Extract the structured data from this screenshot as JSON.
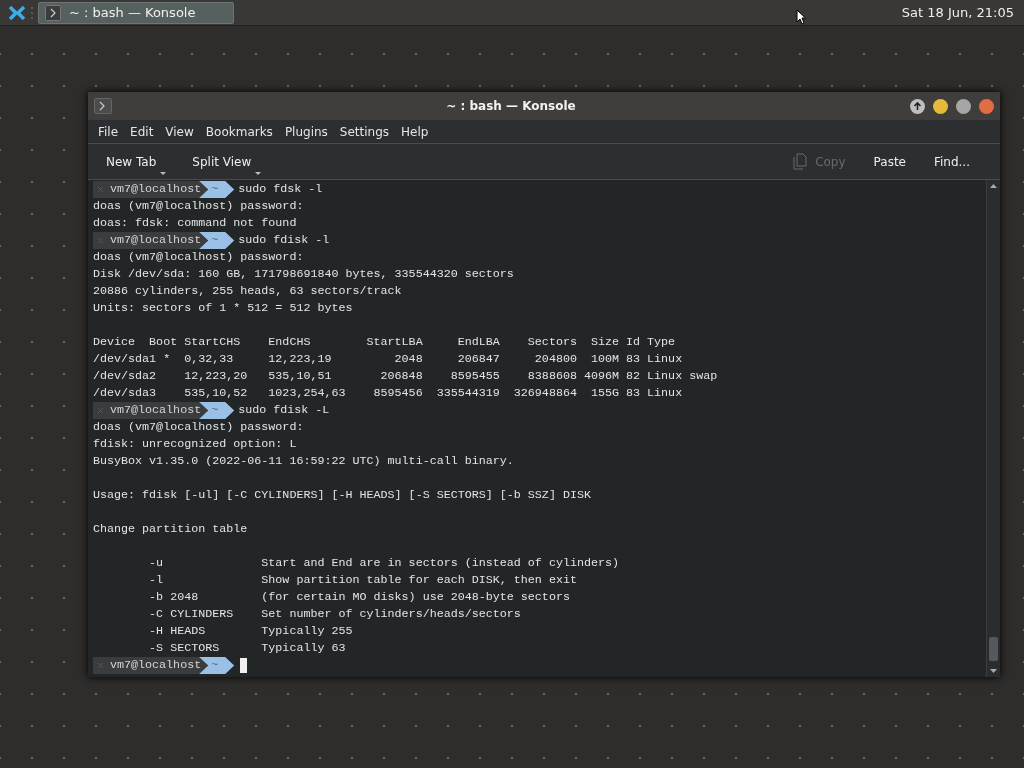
{
  "taskbar": {
    "task": {
      "title": "~ : bash — Konsole",
      "selected": true
    },
    "clock": "Sat 18 Jun, 21:05"
  },
  "window": {
    "title": "~ : bash — Konsole"
  },
  "menu": [
    "File",
    "Edit",
    "View",
    "Bookmarks",
    "Plugins",
    "Settings",
    "Help"
  ],
  "toolbar": [
    {
      "label": "New Tab",
      "dropdown": true,
      "disabled": false
    },
    {
      "label": "Split View",
      "dropdown": true,
      "disabled": false
    },
    {
      "label": "Copy",
      "dropdown": false,
      "disabled": true
    },
    {
      "label": "Paste",
      "dropdown": false,
      "disabled": false
    },
    {
      "label": "Find...",
      "dropdown": false,
      "disabled": false
    }
  ],
  "terminal": {
    "lines": [
      {
        "kind": "prompt",
        "user": "vm7@localhost",
        "dir": "~",
        "command": "sudo fdsk -l"
      },
      {
        "kind": "output",
        "text": "doas (vm7@localhost) password:"
      },
      {
        "kind": "output",
        "text": "doas: fdsk: command not found"
      },
      {
        "kind": "prompt",
        "user": "vm7@localhost",
        "dir": "~",
        "command": "sudo fdisk -l"
      },
      {
        "kind": "output",
        "text": "doas (vm7@localhost) password:"
      },
      {
        "kind": "output",
        "text": "Disk /dev/sda: 160 GB, 171798691840 bytes, 335544320 sectors"
      },
      {
        "kind": "output",
        "text": "20886 cylinders, 255 heads, 63 sectors/track"
      },
      {
        "kind": "output",
        "text": "Units: sectors of 1 * 512 = 512 bytes"
      },
      {
        "kind": "blank"
      },
      {
        "kind": "output",
        "text": "Device  Boot StartCHS    EndCHS        StartLBA     EndLBA    Sectors  Size Id Type"
      },
      {
        "kind": "output",
        "text": "/dev/sda1 *  0,32,33     12,223,19         2048     206847     204800  100M 83 Linux"
      },
      {
        "kind": "output",
        "text": "/dev/sda2    12,223,20   535,10,51       206848    8595455    8388608 4096M 82 Linux swap"
      },
      {
        "kind": "output",
        "text": "/dev/sda3    535,10,52   1023,254,63    8595456  335544319  326948864  155G 83 Linux"
      },
      {
        "kind": "prompt",
        "user": "vm7@localhost",
        "dir": "~",
        "command": "sudo fdisk -L"
      },
      {
        "kind": "output",
        "text": "doas (vm7@localhost) password:"
      },
      {
        "kind": "output",
        "text": "fdisk: unrecognized option: L"
      },
      {
        "kind": "output",
        "text": "BusyBox v1.35.0 (2022-06-11 16:59:22 UTC) multi-call binary."
      },
      {
        "kind": "blank"
      },
      {
        "kind": "output",
        "text": "Usage: fdisk [-ul] [-C CYLINDERS] [-H HEADS] [-S SECTORS] [-b SSZ] DISK"
      },
      {
        "kind": "blank"
      },
      {
        "kind": "output",
        "text": "Change partition table"
      },
      {
        "kind": "blank"
      },
      {
        "kind": "output",
        "text": "        -u              Start and End are in sectors (instead of cylinders)"
      },
      {
        "kind": "output",
        "text": "        -l              Show partition table for each DISK, then exit"
      },
      {
        "kind": "output",
        "text": "        -b 2048         (for certain MO disks) use 2048-byte sectors"
      },
      {
        "kind": "output",
        "text": "        -C CYLINDERS    Set number of cylinders/heads/sectors"
      },
      {
        "kind": "output",
        "text": "        -H HEADS        Typically 255"
      },
      {
        "kind": "output",
        "text": "        -S SECTORS      Typically 63"
      },
      {
        "kind": "prompt",
        "user": "vm7@localhost",
        "dir": "~",
        "cursor": true
      }
    ]
  }
}
